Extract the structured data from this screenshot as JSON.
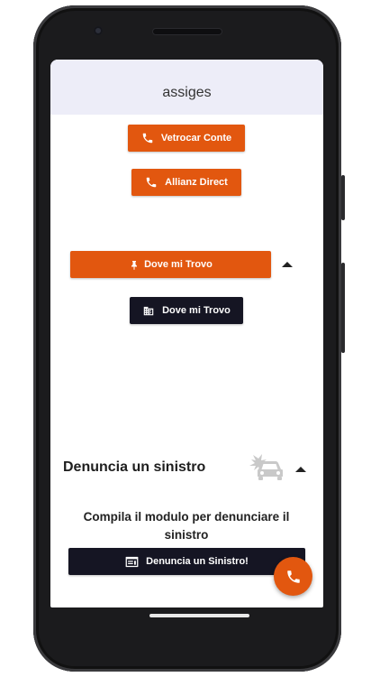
{
  "app": {
    "title": "assiges"
  },
  "contacts": [
    {
      "label": "Vetrocar Conte",
      "icon": "phone-icon"
    },
    {
      "label": "Allianz Direct",
      "icon": "phone-icon"
    }
  ],
  "location": {
    "primary_label": "Dove mi Trovo",
    "primary_icon": "pin-icon",
    "secondary_label": "Dove mi Trovo",
    "secondary_icon": "building-icon",
    "collapse_icon": "caret-up-icon"
  },
  "claim": {
    "title": "Denuncia un sinistro",
    "illustration_icon": "car-crash-icon",
    "collapse_icon": "caret-up-icon",
    "description": "Compila il modulo per denunciare il sinistro",
    "button_label": "Denuncia un Sinistro!",
    "button_icon": "form-icon"
  },
  "fab": {
    "icon": "phone-icon"
  },
  "colors": {
    "accent": "#e2570f",
    "dark": "#151523",
    "header_bg": "#ededf8"
  }
}
